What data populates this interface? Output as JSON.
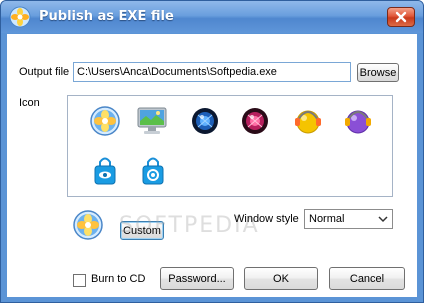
{
  "window": {
    "title": "Publish as EXE file",
    "title_icon": "app-flower-icon",
    "close_icon": "close-icon"
  },
  "form": {
    "output_label": "Output file",
    "output_value": "C:\\Users\\Anca\\Documents\\Softpedia.exe",
    "browse_label": "Browse",
    "icon_label": "Icon",
    "icons": [
      "flower-icon",
      "monitor-icon",
      "blue-globe-icon",
      "pink-globe-icon",
      "yellow-headset-icon",
      "purple-headset-icon",
      "eye-lock-icon",
      "gear-lock-icon"
    ],
    "selected_icon": "flower-icon",
    "custom_label": "Custom",
    "window_style_label": "Window style",
    "window_style_value": "Normal",
    "burn_label": "Burn to CD",
    "burn_checked": false,
    "password_label": "Password...",
    "ok_label": "OK",
    "cancel_label": "Cancel"
  },
  "watermark": "SOFTPEDIA",
  "colors": {
    "title_bar": "#5b94d6",
    "close_button": "#d9502f",
    "input_border": "#7aa7d6"
  }
}
